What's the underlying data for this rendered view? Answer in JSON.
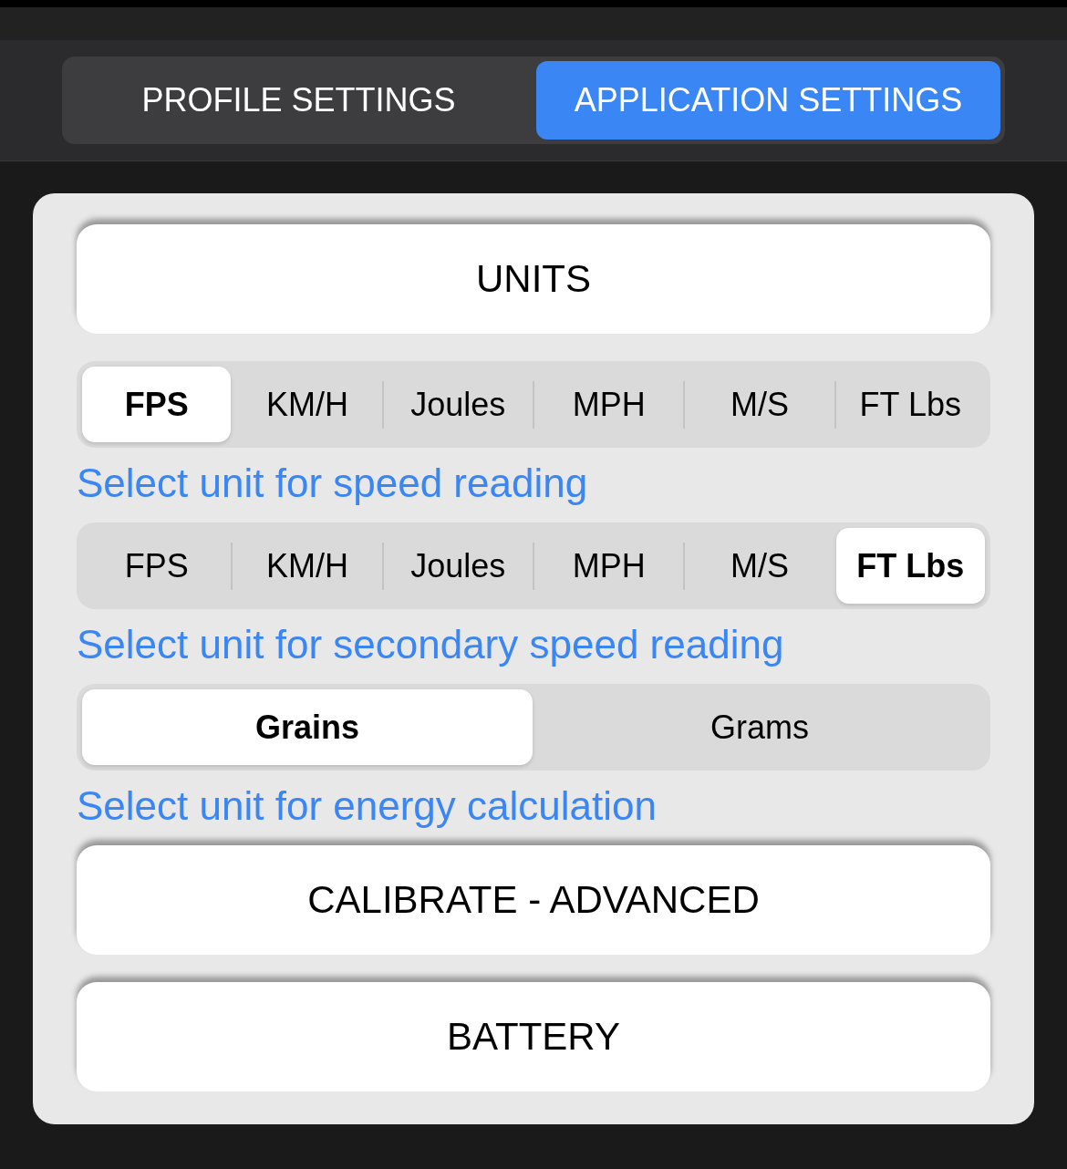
{
  "tabs": [
    {
      "label": "PROFILE SETTINGS",
      "selected": false
    },
    {
      "label": "APPLICATION SETTINGS",
      "selected": true
    }
  ],
  "sections": [
    {
      "kind": "button",
      "label": "UNITS"
    },
    {
      "kind": "segments",
      "options": [
        {
          "label": "FPS",
          "selected": true
        },
        {
          "label": "KM/H",
          "selected": false
        },
        {
          "label": "Joules",
          "selected": false
        },
        {
          "label": "MPH",
          "selected": false
        },
        {
          "label": "M/S",
          "selected": false
        },
        {
          "label": "FT Lbs",
          "selected": false
        }
      ]
    },
    {
      "kind": "hint",
      "text": "Select unit for speed reading"
    },
    {
      "kind": "segments",
      "options": [
        {
          "label": "FPS",
          "selected": false
        },
        {
          "label": "KM/H",
          "selected": false
        },
        {
          "label": "Joules",
          "selected": false
        },
        {
          "label": "MPH",
          "selected": false
        },
        {
          "label": "M/S",
          "selected": false
        },
        {
          "label": "FT Lbs",
          "selected": true
        }
      ]
    },
    {
      "kind": "hint",
      "text": "Select unit for secondary speed reading"
    },
    {
      "kind": "segments",
      "options": [
        {
          "label": "Grains",
          "selected": true
        },
        {
          "label": "Grams",
          "selected": false
        }
      ]
    },
    {
      "kind": "hint",
      "text": "Select unit for energy calculation"
    },
    {
      "kind": "button",
      "label": "CALIBRATE - ADVANCED"
    },
    {
      "kind": "button",
      "label": "BATTERY"
    }
  ]
}
